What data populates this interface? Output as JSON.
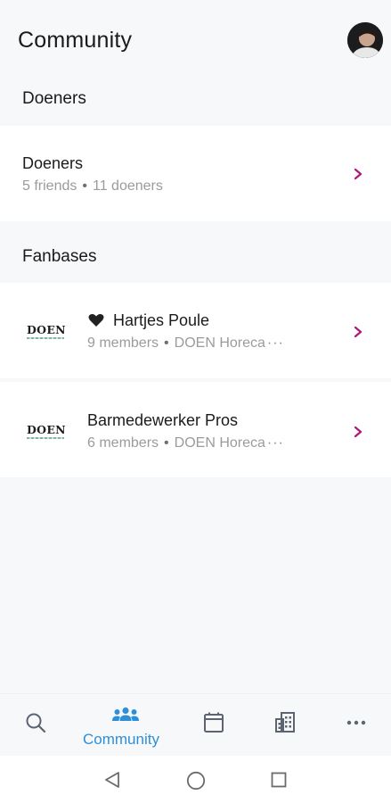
{
  "header": {
    "title": "Community"
  },
  "doeners_section": {
    "title": "Doeners",
    "item": {
      "title": "Doeners",
      "friends": "5 friends",
      "separator": "•",
      "count": "11 doeners"
    }
  },
  "fanbases_section": {
    "title": "Fanbases",
    "items": [
      {
        "logo": "DOEN",
        "favorite": true,
        "name": "Hartjes Poule",
        "members": "9 members",
        "separator": "•",
        "org": "DOEN Horeca",
        "more": "···"
      },
      {
        "logo": "DOEN",
        "favorite": false,
        "name": "Barmedewerker Pros",
        "members": "6 members",
        "separator": "•",
        "org": "DOEN Horeca",
        "more": "···"
      }
    ]
  },
  "tabbar": {
    "tabs": [
      {
        "icon": "search-icon",
        "label": ""
      },
      {
        "icon": "people-icon",
        "label": "Community",
        "active": true
      },
      {
        "icon": "calendar-icon",
        "label": ""
      },
      {
        "icon": "building-icon",
        "label": ""
      },
      {
        "icon": "more-icon",
        "label": ""
      }
    ]
  },
  "colors": {
    "accent": "#2d8fd8",
    "chevron": "#b0167a",
    "background": "#f7f8fa"
  }
}
